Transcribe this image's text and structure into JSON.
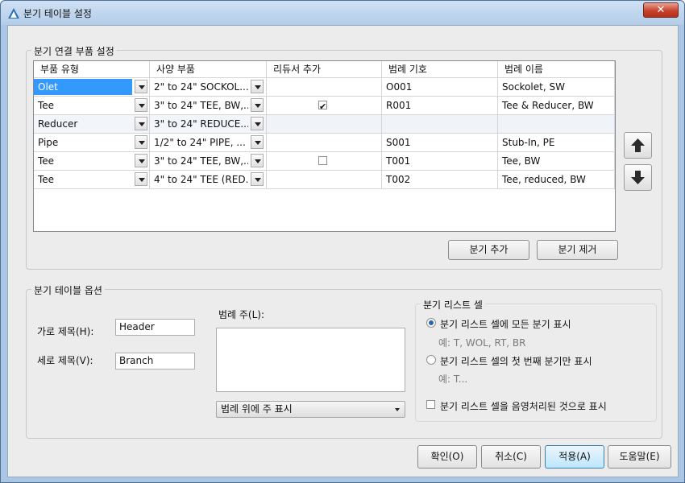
{
  "window": {
    "title": "분기 테이블 설정",
    "close_glyph": "✕"
  },
  "connection_group": {
    "label": "분기 연결 부품 설정",
    "columns": [
      "부품 유형",
      "사양 부품",
      "리듀서 추가",
      "범례 기호",
      "범례 이름"
    ],
    "rows": [
      {
        "type": "Olet",
        "spec": "2\" to 24\"  SOCKOL...",
        "reducer": "",
        "symbol": "O001",
        "name": "Sockolet, SW",
        "highlight": true
      },
      {
        "type": "Tee",
        "spec": "3\" to 24\"  TEE, BW,...",
        "reducer": "checked",
        "symbol": "R001",
        "name": "Tee & Reducer, BW"
      },
      {
        "type": "Reducer",
        "spec": "3\" to 24\"  REDUCE...",
        "reducer": "disabled",
        "symbol": "",
        "name": ""
      },
      {
        "type": "Pipe",
        "spec": "1/2\" to 24\"  PIPE, ...",
        "reducer": "",
        "symbol": "S001",
        "name": "Stub-In, PE"
      },
      {
        "type": "Tee",
        "spec": "3\" to 24\"  TEE, BW,...",
        "reducer": "unchecked",
        "symbol": "T001",
        "name": "Tee, BW"
      },
      {
        "type": "Tee",
        "spec": "4\" to 24\"  TEE (RED...",
        "reducer": "",
        "symbol": "T002",
        "name": "Tee, reduced, BW"
      }
    ],
    "add_button": "분기 추가",
    "remove_button": "분기 제거"
  },
  "options_group": {
    "label": "분기 테이블 옵션",
    "row_title_label": "가로 제목(H):",
    "row_title_value": "Header",
    "col_title_label": "세로 제목(V):",
    "col_title_value": "Branch",
    "legend_note_label": "범례 주(L):",
    "legend_note_position": "범례 위에 주 표시",
    "branch_list_cell": {
      "label": "분기 리스트 셀",
      "opt1": "분기 리스트 셀에 모든 분기 표시",
      "opt1_example": "예: T, WOL, RT, BR",
      "opt2": "분기 리스트 셀의 첫 번째 분기만 표시",
      "opt2_example": "예: T...",
      "shade": "분기 리스트 셀을 음영처리된 것으로 표시"
    }
  },
  "footer": {
    "ok": "확인(O)",
    "cancel": "취소(C)",
    "apply": "적용(A)",
    "help": "도움말(E)"
  },
  "colors": {
    "accent": "#3399ff",
    "titlebar": "#b3cde9",
    "close": "#c7432d"
  }
}
